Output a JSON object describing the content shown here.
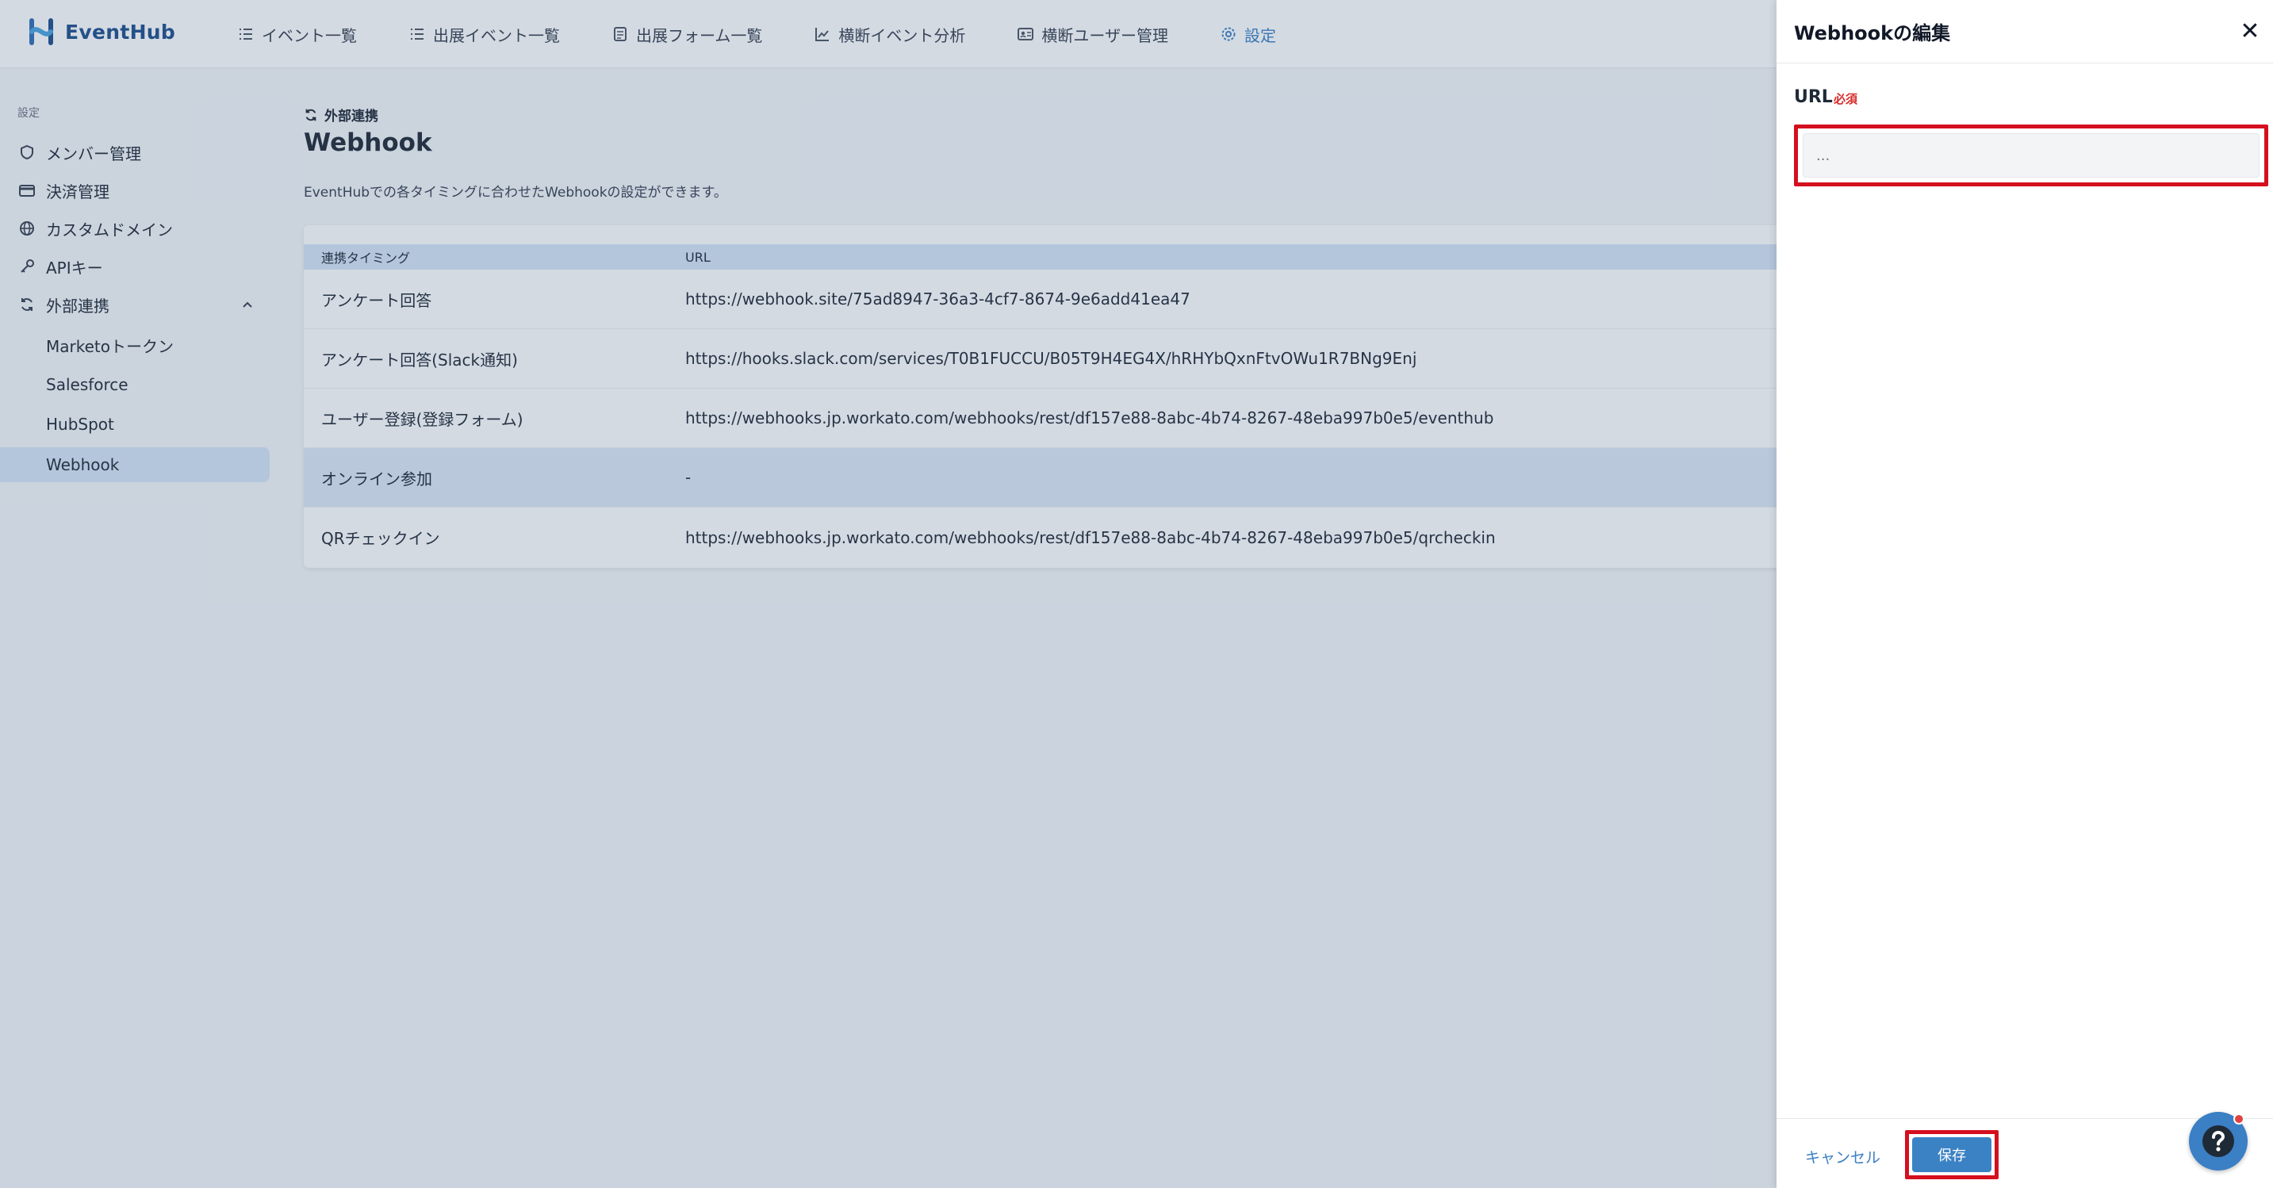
{
  "app": {
    "brand": "EventHub"
  },
  "nav": {
    "items": [
      {
        "label": "イベント一覧",
        "icon": "list-icon"
      },
      {
        "label": "出展イベント一覧",
        "icon": "list-icon"
      },
      {
        "label": "出展フォーム一覧",
        "icon": "form-icon"
      },
      {
        "label": "横断イベント分析",
        "icon": "chart-icon"
      },
      {
        "label": "横断ユーザー管理",
        "icon": "user-card-icon"
      },
      {
        "label": "設定",
        "icon": "gear-icon",
        "active": true
      }
    ]
  },
  "sidebar": {
    "section": "設定",
    "items": [
      {
        "label": "メンバー管理",
        "icon": "shield-icon"
      },
      {
        "label": "決済管理",
        "icon": "card-icon"
      },
      {
        "label": "カスタムドメイン",
        "icon": "globe-icon"
      },
      {
        "label": "APIキー",
        "icon": "key-icon"
      },
      {
        "label": "外部連携",
        "icon": "sync-icon",
        "expanded": true
      }
    ],
    "subitems": [
      {
        "label": "Marketoトークン"
      },
      {
        "label": "Salesforce"
      },
      {
        "label": "HubSpot"
      },
      {
        "label": "Webhook",
        "active": true
      }
    ]
  },
  "main": {
    "breadcrumb": "外部連携",
    "title": "Webhook",
    "description": "EventHubでの各タイミングに合わせたWebhookの設定ができます。",
    "table": {
      "headers": [
        "連携タイミング",
        "URL"
      ],
      "rows": [
        {
          "timing": "アンケート回答",
          "url": "https://webhook.site/75ad8947-36a3-4cf7-8674-9e6add41ea47"
        },
        {
          "timing": "アンケート回答(Slack通知)",
          "url": "https://hooks.slack.com/services/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"
        },
        {
          "timing": "ユーザー登録(登録フォーム)",
          "url": "https://webhooks.jp.workato.com/webhooks/rest/df157e88-8abc-4b74-8267-48eba997b0e5/eventhub"
        },
        {
          "timing": "オンライン参加",
          "url": "-",
          "highlighted": true
        },
        {
          "timing": "QRチェックイン",
          "url": "https://webhooks.jp.workato.com/webhooks/rest/df157e88-8abc-4b74-8267-48eba997b0e5/qrcheckin"
        }
      ]
    }
  },
  "drawer": {
    "title": "Webhookの編集",
    "close": "✕",
    "url_label": "URL",
    "required": "必須",
    "url_value": "",
    "url_placeholder": "...",
    "cancel_label": "キャンセル",
    "save_label": "保存"
  },
  "colors": {
    "accent": "#3b82c4",
    "highlight_box": "#d40f1e",
    "required": "#d72b2b"
  }
}
